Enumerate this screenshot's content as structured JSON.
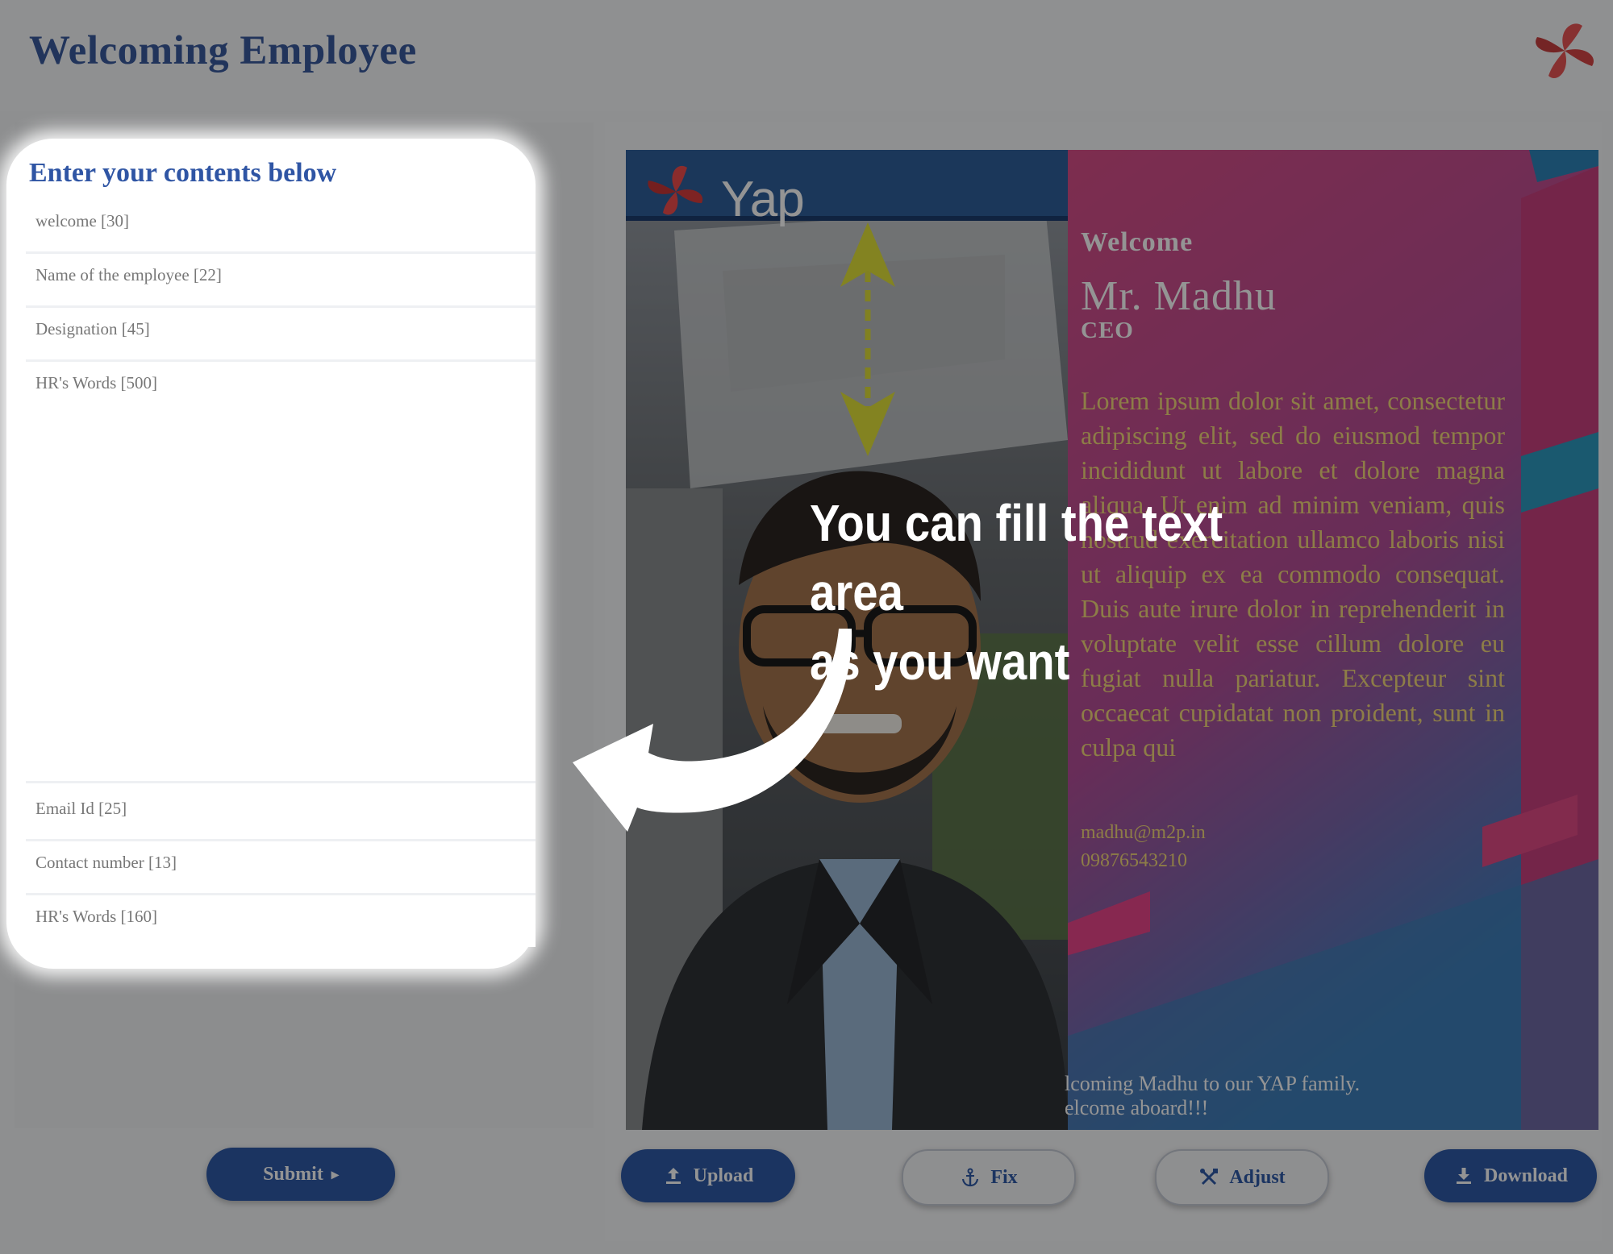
{
  "header": {
    "title": "Welcoming Employee"
  },
  "form": {
    "heading": "Enter your contents below",
    "fields": [
      {
        "placeholder": "welcome [30]"
      },
      {
        "placeholder": "Name of the employee [22]"
      },
      {
        "placeholder": "Designation [45]"
      },
      {
        "placeholder": "HR's Words [500]"
      },
      {
        "placeholder": "Email Id [25]"
      },
      {
        "placeholder": "Contact number [13]"
      },
      {
        "placeholder": "HR's Words [160]"
      }
    ],
    "submit_label": "Submit"
  },
  "card": {
    "brand": "Yap",
    "welcome": "Welcome",
    "name": "Mr. Madhu",
    "designation": "CEO",
    "message": "Lorem ipsum dolor sit amet, consectetur adipiscing elit, sed do eiusmod tempor incididunt ut labore et dolore magna aliqua. Ut enim ad minim veniam, quis nostrud exercitation ullamco laboris nisi ut aliquip ex ea commodo consequat. Duis aute irure dolor in reprehenderit in voluptate velit esse cillum dolore eu fugiat nulla pariatur. Excepteur sint occaecat cupidatat non proident, sunt in culpa qui",
    "email": "madhu@m2p.in",
    "phone": "09876543210",
    "footer_line1": "lcoming Madhu to our YAP family.",
    "footer_line2": "elcome aboard!!!"
  },
  "actions": {
    "upload": "Upload",
    "fix": "Fix",
    "adjust": "Adjust",
    "download": "Download"
  },
  "tooltip": {
    "line1": "You can fill the text area",
    "line2": "as you want"
  },
  "colors": {
    "brand_blue": "#2f5aa8",
    "card_pink": "#d2508e",
    "card_blue": "#2a7fae",
    "card_text_gold": "#f3d77a"
  }
}
